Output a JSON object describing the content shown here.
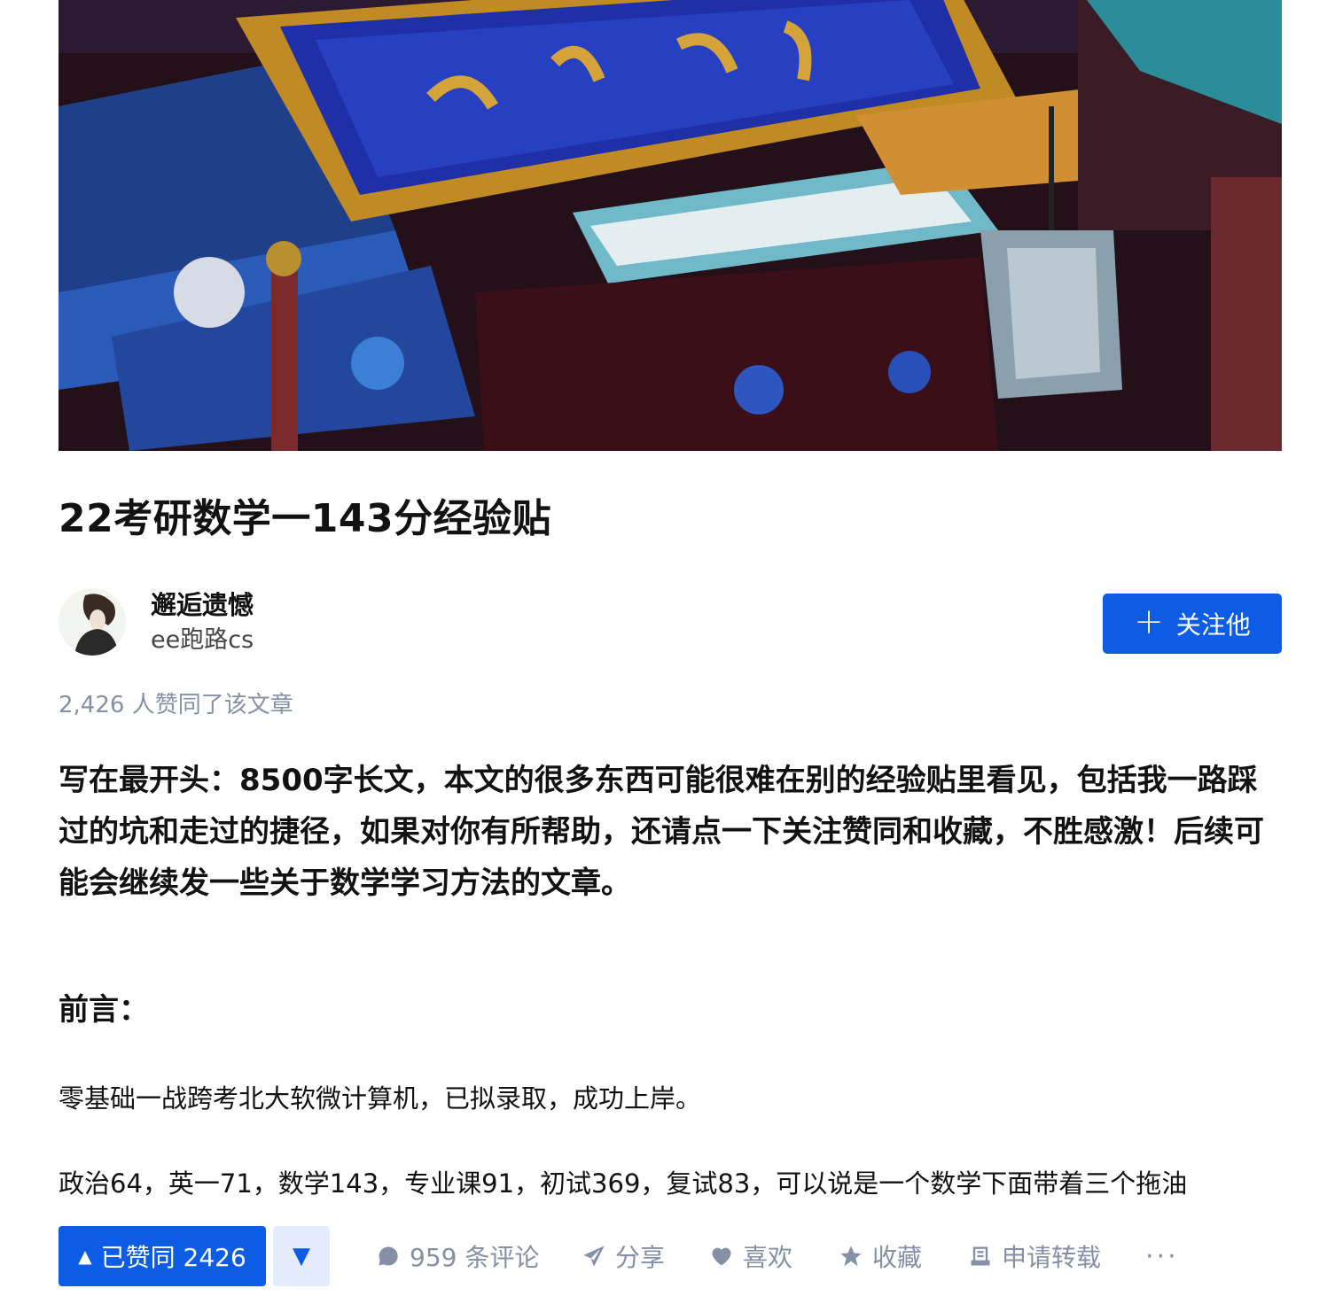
{
  "article": {
    "title": "22考研数学一143分经验贴",
    "author": {
      "name": "邂逅遗憾",
      "bio": "ee跑路cs",
      "follow_label": "关注他"
    },
    "approvers_text": "2,426 人赞同了该文章",
    "intro": "写在最开头：8500字长文，本文的很多东西可能很难在别的经验贴里看见，包括我一路踩过的坑和走过的捷径，如果对你有所帮助，还请点一下关注赞同和收藏，不胜感激！后续可能会继续发一些关于数学学习方法的文章。",
    "preface_heading": "前言：",
    "paragraphs": [
      "零基础一战跨考北大软微计算机，已拟录取，成功上岸。",
      "政治64，英一71，数学143，专业课91，初试369，复试83，可以说是一个数学下面带着三个拖油"
    ]
  },
  "actions": {
    "vote_up_label": "已赞同 2426",
    "comments_label": "959 条评论",
    "share_label": "分享",
    "like_label": "喜欢",
    "collect_label": "收藏",
    "repost_label": "申请转载",
    "more_label": "···"
  },
  "colors": {
    "accent": "#0d5ce6",
    "muted": "#8590a6",
    "text": "#121212"
  }
}
